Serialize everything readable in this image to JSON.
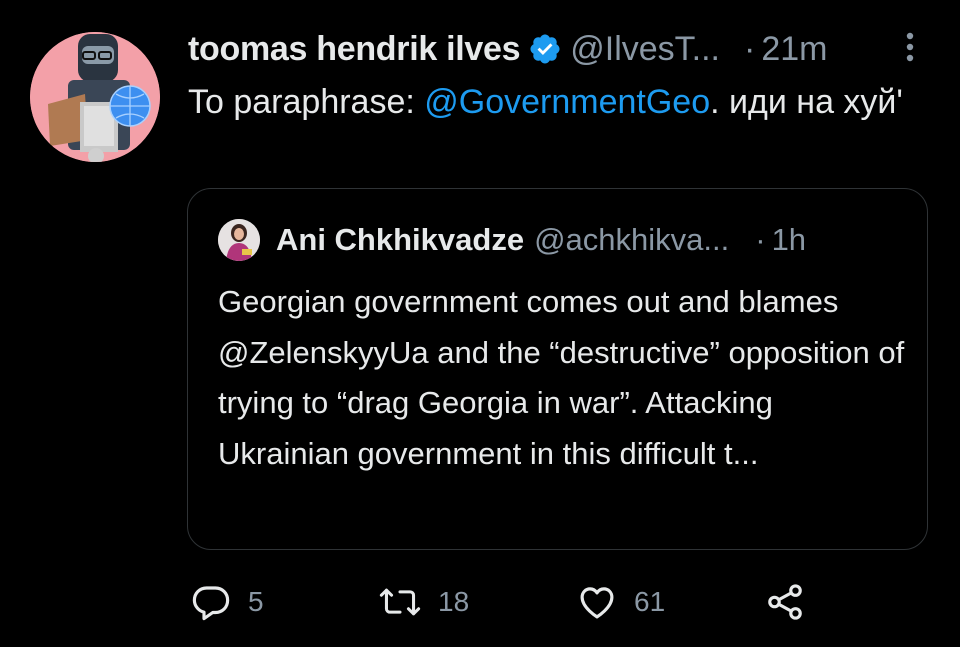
{
  "tweet": {
    "display_name": "toomas hendrik ilves",
    "handle": "@IlvesT...",
    "separator": "·",
    "time": "21m",
    "text_prefix": "To paraphrase: ",
    "text_mention": "@GovernmentGeo",
    "text_suffix": ".  иди на хуй'",
    "avatar_icon": "avatar-photo",
    "verified_icon": "verified-badge-icon",
    "more_icon": "more-vertical-icon"
  },
  "quote": {
    "display_name": "Ani Chkhikvadze",
    "handle": "@achkhikva...",
    "separator": "·",
    "time": "1h",
    "text": "Georgian government comes out and blames @ZelenskyyUa and the “destructive” opposition of trying to “drag Georgia in war”. Attacking Ukrainian government in this difficult t..."
  },
  "actions": {
    "reply_count": "5",
    "retweet_count": "18",
    "like_count": "61"
  },
  "colors": {
    "background": "#000000",
    "text": "#e7e9ea",
    "muted": "#8b98a5",
    "accent": "#1d9bf0",
    "border": "#2f3336"
  }
}
